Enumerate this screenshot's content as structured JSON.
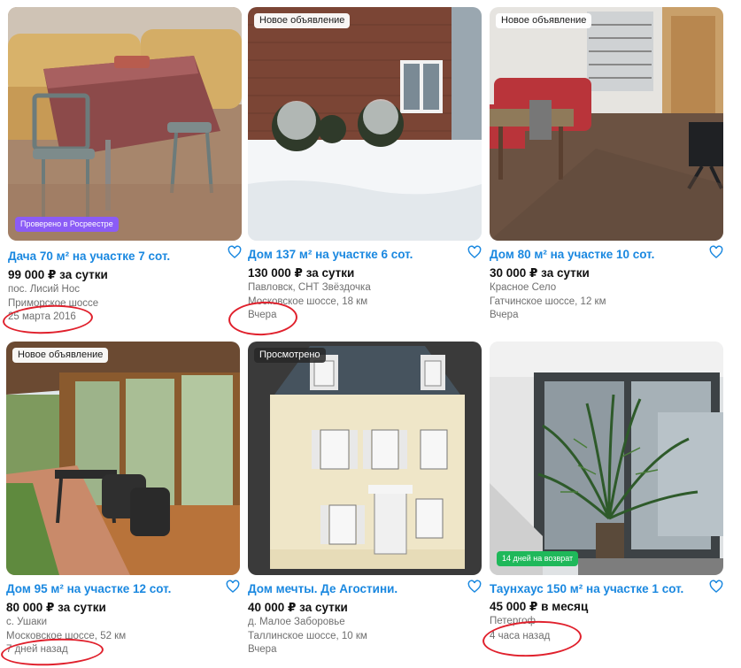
{
  "listings": [
    {
      "title": "Дача 70 м² на участке 7 сот.",
      "price": "99 000 ₽ за сутки",
      "location": "пос. Лисий Нос",
      "road": "Приморское шоссе",
      "date": "25 марта 2016",
      "badge_bottom": "Проверено в Росреестре",
      "badge_bottom_color": "#8b5cf6"
    },
    {
      "badge_top": "Новое объявление",
      "title": "Дом 137 м² на участке 6 сот.",
      "price": "130 000 ₽ за сутки",
      "location": "Павловск, СНТ Звёздочка",
      "road": "Московское шоссе, 18 км",
      "date": "Вчера"
    },
    {
      "badge_top": "Новое объявление",
      "title": "Дом 80 м² на участке 10 сот.",
      "price": "30 000 ₽ за сутки",
      "location": "Красное Село",
      "road": "Гатчинское шоссе, 12 км",
      "date": "Вчера"
    },
    {
      "badge_top": "Новое объявление",
      "title": "Дом 95 м² на участке 12 сот.",
      "price": "80 000 ₽ за сутки",
      "location": "с. Ушаки",
      "road": "Московское шоссе, 52 км",
      "date": "7 дней назад"
    },
    {
      "badge_top": "Просмотрено",
      "title": "Дом мечты. Де Агостини.",
      "price": "40 000 ₽ за сутки",
      "location": "д. Малое Заборовье",
      "road": "Таллинское шоссе, 10 км",
      "date": "Вчера"
    },
    {
      "title": "Таунхаус 150 м² на участке 1 сот.",
      "price": "45 000 ₽ в месяц",
      "location": "Петергоф",
      "date": "4 часа назад",
      "badge_bottom": "14 дней на возврат",
      "badge_bottom_color": "#1fb85a"
    }
  ],
  "colors": {
    "title": "#1a88e0",
    "annotation": "#e0202c"
  },
  "icons": {
    "favorite": "heart-icon"
  }
}
